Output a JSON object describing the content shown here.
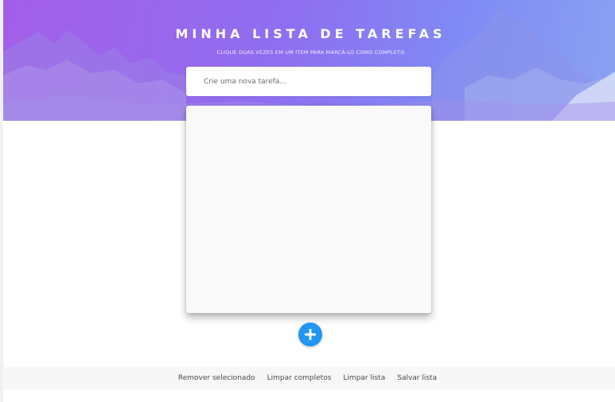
{
  "header": {
    "title": "MINHA LISTA DE TAREFAS",
    "subtitle": "CLIQUE DUAS VEZES EM UM ITEM PARA MARCÁ-LO COMO COMPLETO"
  },
  "task_input": {
    "placeholder": "Crie uma nova tarefa...",
    "value": ""
  },
  "task_list": {
    "items": []
  },
  "add_button": {
    "icon": "plus-icon",
    "color": "#2196f3"
  },
  "footer": {
    "remove_selected": "Remover selecionado",
    "clear_completed": "Limpar completos",
    "clear_list": "Limpar lista",
    "save_list": "Salvar lista"
  },
  "colors": {
    "header_gradient_start": "#a35ee8",
    "header_gradient_end": "#8aa2f1",
    "accent": "#2196f3"
  }
}
